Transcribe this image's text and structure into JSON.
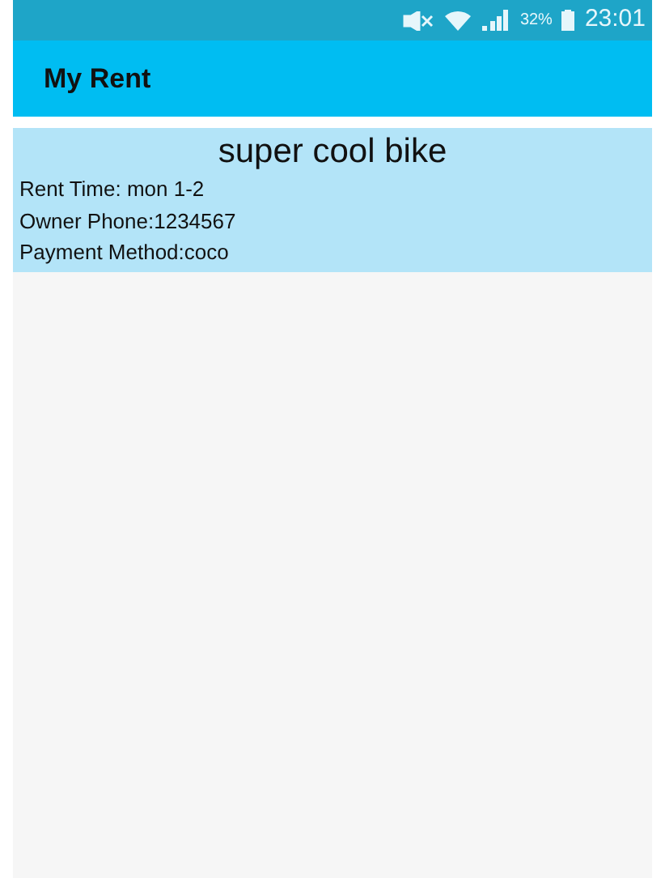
{
  "status_bar": {
    "battery": "32%",
    "time": "23:01"
  },
  "app_bar": {
    "title": "My Rent"
  },
  "rentals": [
    {
      "title": "super cool bike",
      "lines": [
        "Rent Time: mon 1-2",
        "Owner Phone:1234567",
        "Payment Method:coco"
      ]
    }
  ]
}
